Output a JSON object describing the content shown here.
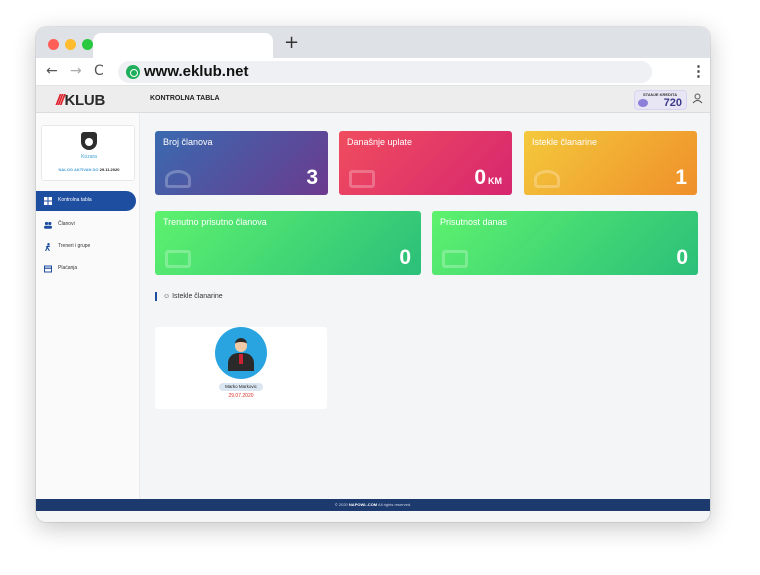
{
  "browser": {
    "url": "www.eklub.net",
    "new_tab_glyph": "+",
    "back_glyph": "←",
    "forward_glyph": "→",
    "reload_glyph": "C",
    "menu_glyph": "⋮"
  },
  "header": {
    "logo_mark": "///",
    "logo_text": "KLUB",
    "page_title": "KONTROLNA TABLA",
    "credit_label": "STANJE KREDITA",
    "credit_value": "720"
  },
  "sidebar": {
    "club_name": "Kozara",
    "status_prefix": "NALOG AKTIVAN DO",
    "status_date": "29.11.2020",
    "items": [
      {
        "label": "Kontrolna tabla",
        "icon": "dashboard-icon",
        "active": true
      },
      {
        "label": "Članovi",
        "icon": "users-icon",
        "active": false
      },
      {
        "label": "Treneri i grupe",
        "icon": "trainer-icon",
        "active": false
      },
      {
        "label": "Plaćanja",
        "icon": "payment-icon",
        "active": false
      }
    ]
  },
  "cards": [
    {
      "title": "Broj članova",
      "value": "3",
      "unit": "",
      "colors": [
        "#3a6ab0",
        "#6b3a8e"
      ]
    },
    {
      "title": "Današnje uplate",
      "value": "0",
      "unit": "KM",
      "colors": [
        "#f04d5e",
        "#d6266f"
      ]
    },
    {
      "title": "Istekle članarine",
      "value": "1",
      "unit": "",
      "colors": [
        "#f4c93c",
        "#ef8f2a"
      ]
    },
    {
      "title": "Trenutno prisutno članova",
      "value": "0",
      "unit": "",
      "colors": [
        "#5ef26e",
        "#2bbf7a"
      ]
    },
    {
      "title": "Prisutnost danas",
      "value": "0",
      "unit": "",
      "colors": [
        "#5ef26e",
        "#2bbf7a"
      ]
    }
  ],
  "section": {
    "title": "Istekle članarine"
  },
  "expired": [
    {
      "name": "Marko Markovic",
      "date": "29.07.2020"
    }
  ],
  "footer": {
    "year": "© 2020",
    "brand": "NAPOWL.COM",
    "rights": "All rights reserved."
  }
}
